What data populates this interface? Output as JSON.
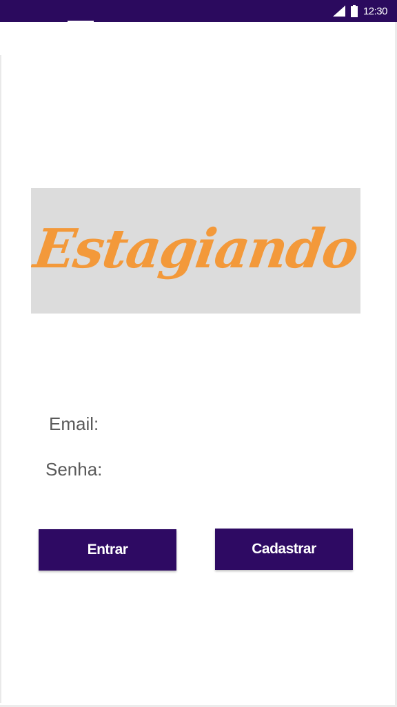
{
  "status_bar": {
    "time": "12:30",
    "background": "#2b0a5e"
  },
  "logo": {
    "text": "Estagiando",
    "color": "#f3993a",
    "background": "#dcdcdc"
  },
  "form": {
    "email_label": "Email:",
    "password_label": "Senha:"
  },
  "buttons": {
    "login_label": "Entrar",
    "register_label": "Cadastrar",
    "color": "#2e0a63"
  }
}
